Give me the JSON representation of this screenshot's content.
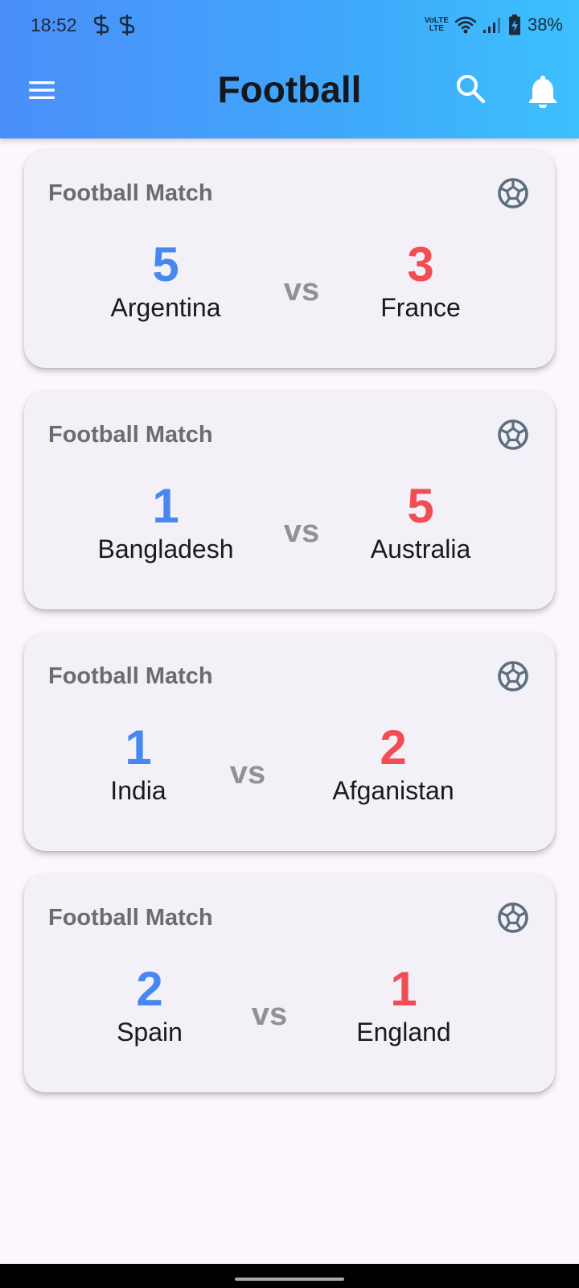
{
  "status_bar": {
    "time": "18:52",
    "network_label": "LTE",
    "battery": "38%"
  },
  "app_bar": {
    "title": "Football",
    "menu_icon": "menu-icon",
    "search_icon": "search-icon",
    "notification_icon": "bell-icon"
  },
  "matches": [
    {
      "title": "Football Match",
      "home_team": "Argentina",
      "home_score": "5",
      "vs": "vs",
      "away_team": "France",
      "away_score": "3"
    },
    {
      "title": "Football Match",
      "home_team": "Bangladesh",
      "home_score": "1",
      "vs": "vs",
      "away_team": "Australia",
      "away_score": "5"
    },
    {
      "title": "Football Match",
      "home_team": "India",
      "home_score": "1",
      "vs": "vs",
      "away_team": "Afganistan",
      "away_score": "2"
    },
    {
      "title": "Football Match",
      "home_team": "Spain",
      "home_score": "2",
      "vs": "vs",
      "away_team": "England",
      "away_score": "1"
    }
  ],
  "colors": {
    "header_start": "#4b8ef9",
    "header_end": "#3cc0fc",
    "home_score": "#4688f0",
    "away_score": "#f24d52",
    "card_background": "#f4f0f7"
  }
}
